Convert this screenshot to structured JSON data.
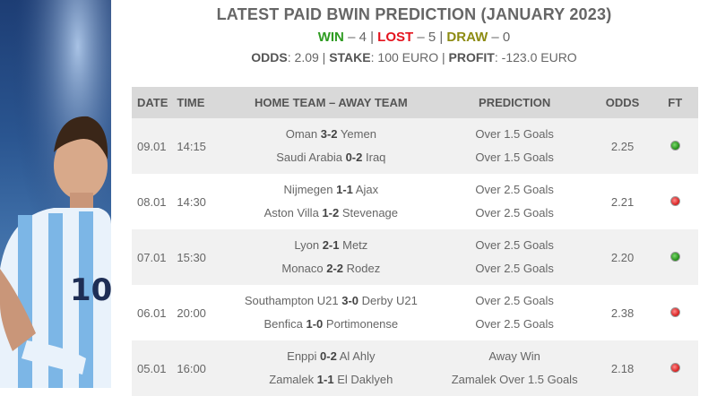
{
  "header": {
    "title": "LATEST PAID BWIN PREDICTION (JANUARY 2023)",
    "record": {
      "win_label": "WIN",
      "win_value": "– 4 |",
      "lost_label": "LOST",
      "lost_value": "– 5 |",
      "draw_label": "DRAW",
      "draw_value": "– 0"
    },
    "summary": {
      "odds_label": "ODDS",
      "odds_value": ": 2.09 |",
      "stake_label": "STAKE",
      "stake_value": ": 100 EURO |",
      "profit_label": "PROFIT",
      "profit_value": ": -123.0 EURO"
    }
  },
  "table": {
    "columns": {
      "date": "DATE",
      "time": "TIME",
      "match": "HOME TEAM – AWAY TEAM",
      "prediction": "PREDICTION",
      "odds": "ODDS",
      "ft": "FT"
    },
    "rows": [
      {
        "date": "09.01",
        "time": "14:15",
        "matches": [
          {
            "home": "Oman",
            "score": "3-2",
            "away": "Yemen",
            "prediction": "Over 1.5 Goals"
          },
          {
            "home": "Saudi Arabia",
            "score": "0-2",
            "away": "Iraq",
            "prediction": "Over 1.5 Goals"
          }
        ],
        "odds": "2.25",
        "result": "win"
      },
      {
        "date": "08.01",
        "time": "14:30",
        "matches": [
          {
            "home": "Nijmegen",
            "score": "1-1",
            "away": "Ajax",
            "prediction": "Over 2.5 Goals"
          },
          {
            "home": "Aston Villa",
            "score": "1-2",
            "away": "Stevenage",
            "prediction": "Over 2.5 Goals"
          }
        ],
        "odds": "2.21",
        "result": "loss"
      },
      {
        "date": "07.01",
        "time": "15:30",
        "matches": [
          {
            "home": "Lyon",
            "score": "2-1",
            "away": "Metz",
            "prediction": "Over 2.5 Goals"
          },
          {
            "home": "Monaco",
            "score": "2-2",
            "away": "Rodez",
            "prediction": "Over 2.5 Goals"
          }
        ],
        "odds": "2.20",
        "result": "win"
      },
      {
        "date": "06.01",
        "time": "20:00",
        "matches": [
          {
            "home": "Southampton U21",
            "score": "3-0",
            "away": "Derby U21",
            "prediction": "Over 2.5 Goals"
          },
          {
            "home": "Benfica",
            "score": "1-0",
            "away": "Portimonense",
            "prediction": "Over 2.5 Goals"
          }
        ],
        "odds": "2.38",
        "result": "loss"
      },
      {
        "date": "05.01",
        "time": "16:00",
        "matches": [
          {
            "home": "Enppi",
            "score": "0-2",
            "away": "Al Ahly",
            "prediction": "Away Win"
          },
          {
            "home": "Zamalek",
            "score": "1-1",
            "away": "El Daklyeh",
            "prediction": "Zamalek Over 1.5 Goals"
          }
        ],
        "odds": "2.18",
        "result": "loss"
      }
    ]
  },
  "colors": {
    "win": "#2f9c22",
    "lost": "#e4141e",
    "draw": "#8d8b12",
    "header_bg": "#d9d9d9",
    "row_alt_bg": "#f1f1f1"
  },
  "icons": {
    "win": "green-dot-icon",
    "loss": "red-dot-icon"
  }
}
